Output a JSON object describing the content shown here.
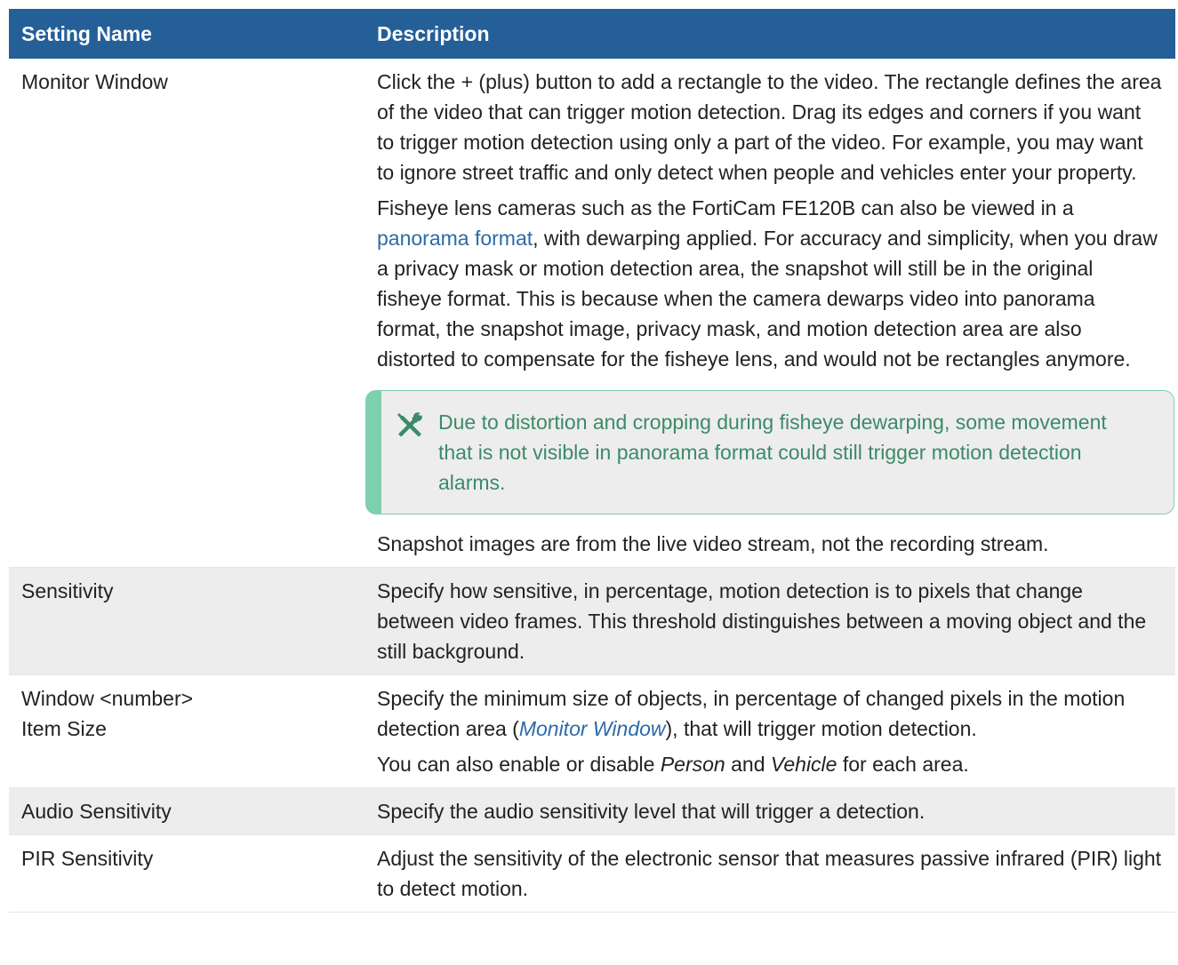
{
  "table": {
    "headers": {
      "setting_name": "Setting Name",
      "description": "Description"
    },
    "rows": {
      "monitor_window": {
        "name": "Monitor Window",
        "p1": "Click the + (plus) button to add a rectangle to the video. The rectangle defines the area of the video that can trigger motion detection. Drag its edges and corners if you want to trigger motion detection using only a part of the video. For example, you may want to ignore street traffic and only detect when people and vehicles enter your property.",
        "p2_before": "Fisheye lens cameras such as the FortiCam FE120B can also be viewed in a ",
        "p2_link": "panorama format",
        "p2_after": ", with dewarping applied. For accuracy and simplicity, when you draw a privacy mask or motion detection area, the snapshot will still be in the original fisheye format. This is because when the camera dewarps video into panorama format, the snapshot image, privacy mask, and motion detection area are also distorted to compensate for the fisheye lens, and would not be rectangles anymore.",
        "note": "Due to distortion and cropping during fisheye dewarping, some movement that is not visible in panorama format could still trigger motion detection alarms.",
        "note_icon": "tools-icon",
        "p3": "Snapshot images are from the live video stream, not the recording stream."
      },
      "sensitivity": {
        "name": "Sensitivity",
        "desc": "Specify how sensitive, in percentage, motion detection is to pixels that change between video frames. This threshold distinguishes between a moving object and the still background."
      },
      "item_size": {
        "name_line1": "Window <number>",
        "name_line2": "Item Size",
        "p1_before": "Specify the minimum size of objects, in percentage of changed pixels in the motion detection area (",
        "p1_link": "Monitor Window",
        "p1_after": "), that will trigger motion detection.",
        "p2_before": "You can also enable or disable ",
        "p2_em1": "Person",
        "p2_mid": " and ",
        "p2_em2": "Vehicle",
        "p2_after": " for each area."
      },
      "audio_sensitivity": {
        "name": "Audio Sensitivity",
        "desc": "Specify the audio sensitivity level that will trigger a detection."
      },
      "pir_sensitivity": {
        "name": "PIR Sensitivity",
        "desc": "Adjust the sensitivity of the electronic sensor that measures passive infrared (PIR) light to detect motion."
      }
    }
  },
  "colors": {
    "header_bg": "#245f98",
    "row_alt_bg": "#ededed",
    "link": "#2d6aa8",
    "note_accent": "#7fd0ad",
    "note_text": "#3c8a6a"
  }
}
